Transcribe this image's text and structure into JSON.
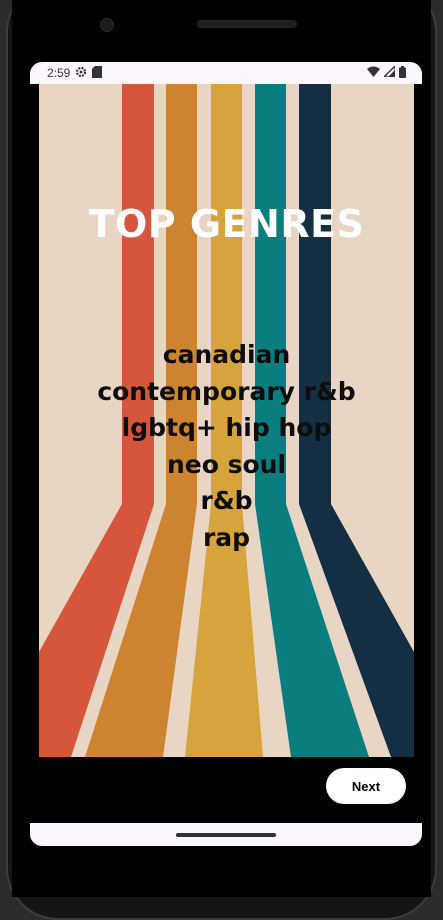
{
  "status_bar": {
    "time": "2:59",
    "icons": [
      "settings-gear-icon",
      "sd-card-icon",
      "wifi-icon",
      "cell-signal-icon",
      "battery-icon"
    ]
  },
  "main": {
    "title": "TOP GENRES",
    "genres": [
      "canadian",
      "contemporary r&b",
      "lgbtq+ hip hop",
      "neo soul",
      "r&b",
      "rap"
    ]
  },
  "footer": {
    "next_label": "Next"
  },
  "colors": {
    "background": "#e8d5c4",
    "stripe_red": "#d5563d",
    "stripe_orange": "#cd8431",
    "stripe_yellow": "#d7a33c",
    "stripe_teal": "#0a7e7f",
    "stripe_navy": "#142e44"
  }
}
